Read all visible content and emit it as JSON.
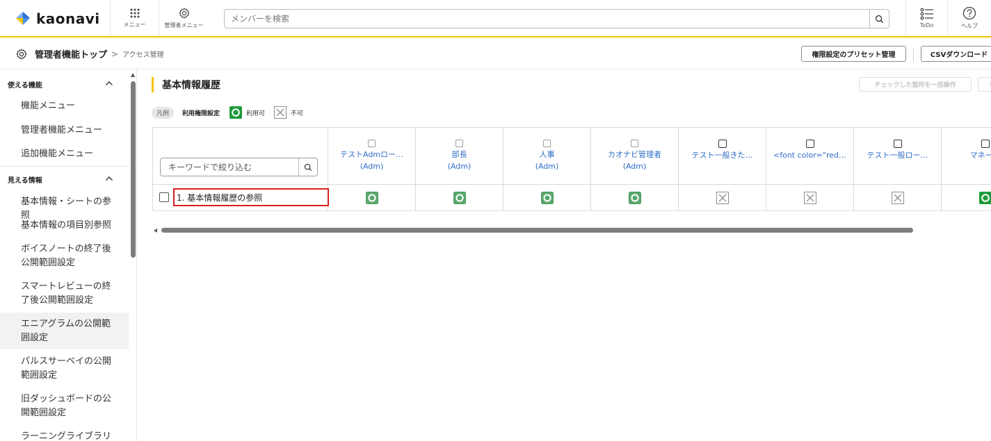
{
  "header": {
    "logo_text": "kaonavi",
    "menu_caption": "メニュー",
    "admin_menu_caption": "管理者メニュー",
    "search_placeholder": "メンバーを検索",
    "todo_caption": "ToDo",
    "help_caption": "ヘルプ",
    "accent_color": "#f5c400"
  },
  "breadcrumb": {
    "top": "管理者機能トップ",
    "separator": ">",
    "current": "アクセス管理",
    "preset_button": "権限設定のプリセット管理",
    "csv_button": "CSVダウンロード"
  },
  "sidebar": {
    "sections": [
      {
        "label": "使える機能",
        "items": [
          "機能メニュー",
          "管理者機能メニュー",
          "追加機能メニュー"
        ]
      },
      {
        "label": "見える情報",
        "items": [
          "基本情報・シートの参照",
          "基本情報の項目別参照",
          "ボイスノートの終了後公開範囲設定",
          "スマートレビューの終了後公開範囲設定",
          "エニアグラムの公開範囲設定",
          "パルスサーベイの公開範囲設定",
          "旧ダッシュボードの公開範囲設定",
          "ラーニングライブラリの"
        ]
      }
    ],
    "active_item": "エニアグラムの公開範囲設定"
  },
  "main": {
    "title": "基本情報履歴",
    "bulk_button": "チェックした箇所を一括操作",
    "bulk_button2": "リ",
    "legend": {
      "tag": "凡例",
      "title": "利用権限設定",
      "allowed": "利用可",
      "denied": "不可",
      "allowed_color": "#1e9b3c"
    },
    "keyword_placeholder": "キーワードで絞り込む",
    "columns": [
      {
        "name": "テストAdmロー…",
        "sub": "(Adm)"
      },
      {
        "name": "部長",
        "sub": "(Adm)"
      },
      {
        "name": "人事",
        "sub": "(Adm)"
      },
      {
        "name": "カオナビ管理者",
        "sub": "(Adm)"
      },
      {
        "name": "テスト一般きた…",
        "sub": ""
      },
      {
        "name": "<font color=\"red…",
        "sub": ""
      },
      {
        "name": "テスト一般ロー…",
        "sub": ""
      },
      {
        "name": "マネージ",
        "sub": ""
      }
    ],
    "row": {
      "label": "1. 基本情報履歴の参照",
      "permissions": [
        "allowed",
        "allowed",
        "allowed",
        "allowed",
        "denied",
        "denied",
        "denied",
        "allowed"
      ]
    }
  }
}
